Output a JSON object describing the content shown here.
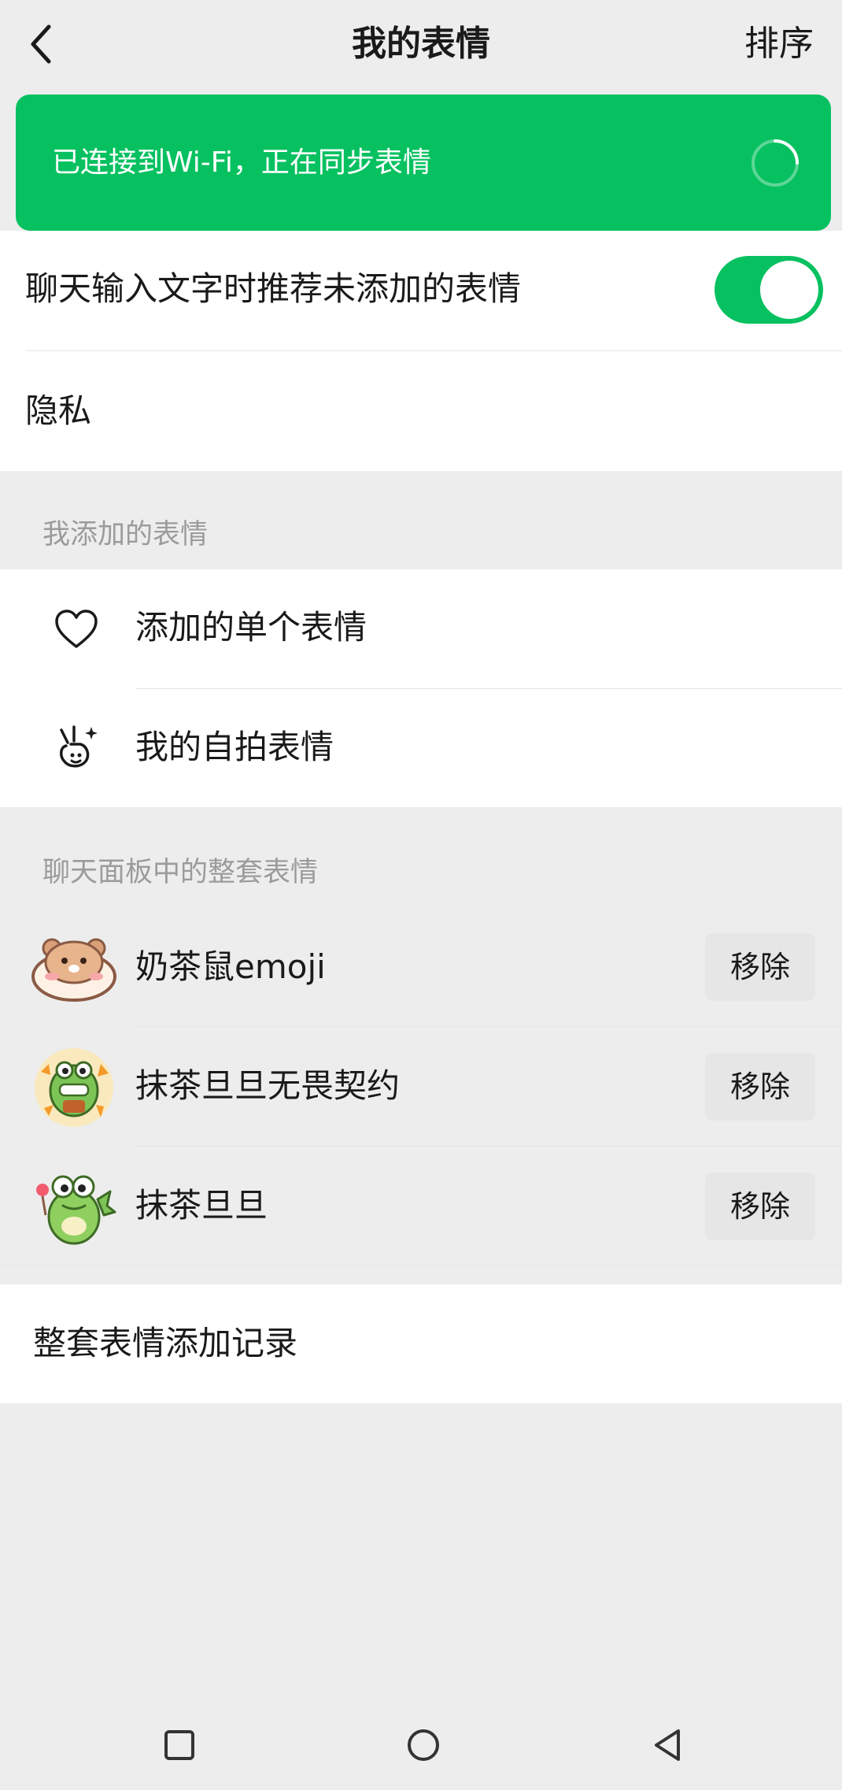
{
  "header": {
    "title": "我的表情",
    "sort_label": "排序",
    "back_icon": "chevron-left-icon"
  },
  "sync_banner": {
    "text": "已连接到Wi-Fi，正在同步表情",
    "color": "#07c160",
    "spinner_icon": "loading-spinner-icon"
  },
  "settings": {
    "recommend_label": "聊天输入文字时推荐未添加的表情",
    "recommend_enabled": true,
    "privacy_label": "隐私"
  },
  "my_added": {
    "section_title": "我添加的表情",
    "items": [
      {
        "label": "添加的单个表情",
        "icon": "heart-icon"
      },
      {
        "label": "我的自拍表情",
        "icon": "selfie-hand-icon"
      }
    ]
  },
  "panel_packs": {
    "section_title": "聊天面板中的整套表情",
    "remove_label": "移除",
    "items": [
      {
        "name": "奶茶鼠emoji",
        "thumb": "hamster-sticker"
      },
      {
        "name": "抹茶旦旦无畏契约",
        "thumb": "crocodile-gamer-sticker"
      },
      {
        "name": "抹茶旦旦",
        "thumb": "crocodile-sticker"
      }
    ]
  },
  "history": {
    "label": "整套表情添加记录"
  },
  "nav_bar": {
    "icons": [
      "recent-apps-icon",
      "home-icon",
      "back-triangle-icon"
    ]
  }
}
